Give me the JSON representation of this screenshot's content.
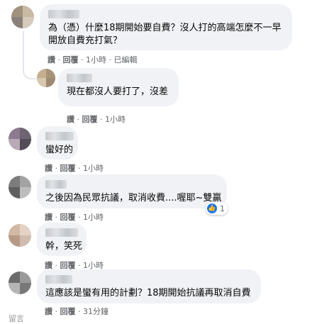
{
  "comments": [
    {
      "text_lines": [
        "為（憑）什麼18期開始要自費？沒人打的高端怎麼不一早",
        "開放自費充打氣？"
      ],
      "actions": [
        "讚",
        "回覆",
        "1小時",
        "已編輯"
      ]
    },
    {
      "text_lines": [
        "現在都沒人要打了，沒差"
      ],
      "actions": [
        "讚",
        "回覆",
        "1小時"
      ]
    },
    {
      "text_lines": [
        "蠻好的"
      ],
      "actions": [
        "讚",
        "回覆",
        "1小時"
      ]
    },
    {
      "text_lines": [
        "之後因為民眾抗議，取消收費....喔耶~雙贏"
      ],
      "actions": [
        "讚",
        "回覆",
        "1小時"
      ],
      "reaction": {
        "icon": "thumbs-up-icon",
        "count": "1"
      }
    },
    {
      "text_lines": [
        "幹，笑死"
      ],
      "actions": [
        "讚",
        "回覆",
        "1小時"
      ]
    },
    {
      "text_lines": [
        "這應該是蠻有用的計劃？18期開始抗議再取消自費"
      ],
      "actions": [
        "讚",
        "回覆",
        "31分鐘"
      ]
    }
  ],
  "footer_partial": "留言",
  "colors": {
    "bubble": "#f0f2f5",
    "meta": "#65676b",
    "like_blue": "#1877f2"
  }
}
